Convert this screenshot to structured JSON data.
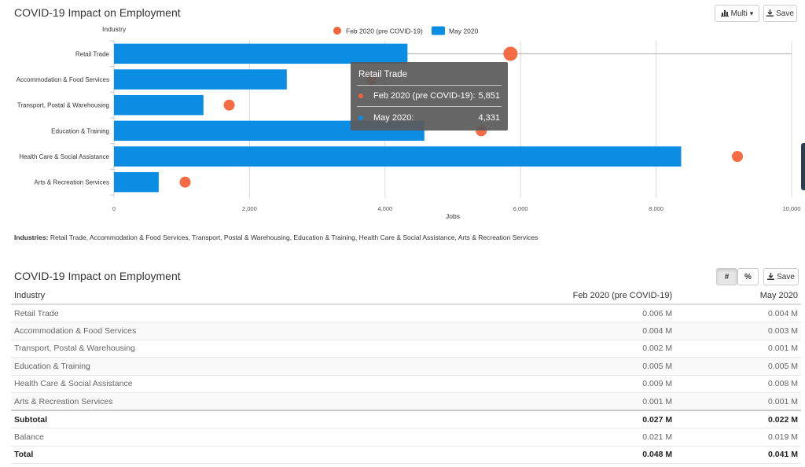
{
  "chart_section": {
    "title": "COVID-19 Impact on Employment",
    "multi_label": "Multi",
    "save_label": "Save",
    "industries_prefix": "Industries:",
    "industries_list": "Retail Trade, Accommodation & Food Services, Transport, Postal & Warehousing, Education & Training, Health Care & Social Assistance, Arts & Recreation Services"
  },
  "chart_data": {
    "type": "bar",
    "orientation": "horizontal",
    "categories": [
      "Retail Trade",
      "Accommodation & Food Services",
      "Transport, Postal & Warehousing",
      "Education & Training",
      "Health Care & Social Assistance",
      "Arts & Recreation Services"
    ],
    "series": [
      {
        "name": "Feb 2020 (pre COVID-19)",
        "type": "scatter",
        "color": "#f4633a",
        "values": [
          5851,
          3800,
          1700,
          5420,
          9200,
          1050
        ]
      },
      {
        "name": "May 2020",
        "type": "bar",
        "color": "#0b8de3",
        "values": [
          4331,
          2550,
          1320,
          4580,
          8370,
          660
        ]
      }
    ],
    "ylabel": "Industry",
    "xlabel": "Jobs",
    "xlim": [
      0,
      10000
    ],
    "xticks": [
      "0",
      "2,000",
      "4,000",
      "6,000",
      "8,000",
      "10,000"
    ],
    "legend_position": "top-center",
    "grid": true,
    "highlighted_category": "Retail Trade"
  },
  "tooltip": {
    "title": "Retail Trade",
    "rows": [
      {
        "label": "Feb 2020 (pre COVID-19):",
        "value": "5,851",
        "color": "#f4633a"
      },
      {
        "label": "May 2020:",
        "value": "4,331",
        "color": "#0b8de3"
      }
    ]
  },
  "table_section": {
    "title": "COVID-19 Impact on Employment",
    "hash_label": "#",
    "percent_label": "%",
    "save_label": "Save",
    "headers": [
      "Industry",
      "Feb 2020 (pre COVID-19)",
      "May 2020"
    ],
    "rows": [
      {
        "industry": "Retail Trade",
        "feb": "0.006 M",
        "may": "0.004 M"
      },
      {
        "industry": "Accommodation & Food Services",
        "feb": "0.004 M",
        "may": "0.003 M"
      },
      {
        "industry": "Transport, Postal & Warehousing",
        "feb": "0.002 M",
        "may": "0.001 M"
      },
      {
        "industry": "Education & Training",
        "feb": "0.005 M",
        "may": "0.005 M"
      },
      {
        "industry": "Health Care & Social Assistance",
        "feb": "0.009 M",
        "may": "0.008 M"
      },
      {
        "industry": "Arts & Recreation Services",
        "feb": "0.001 M",
        "may": "0.001 M"
      }
    ],
    "subtotal": {
      "industry": "Subtotal",
      "feb": "0.027 M",
      "may": "0.022 M"
    },
    "balance": {
      "industry": "Balance",
      "feb": "0.021 M",
      "may": "0.019 M"
    },
    "total": {
      "industry": "Total",
      "feb": "0.048 M",
      "may": "0.041 M"
    }
  }
}
